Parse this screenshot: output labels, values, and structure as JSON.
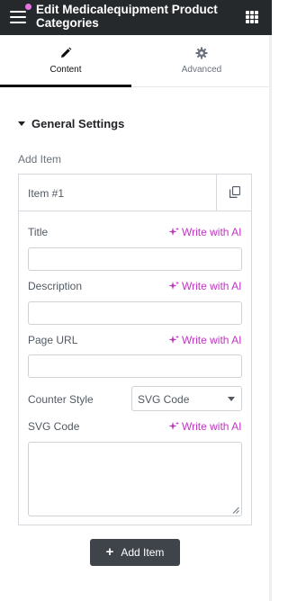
{
  "header": {
    "title": "Edit Medicalequipment Product Categories"
  },
  "tabs": [
    {
      "label": "Content",
      "icon": "pencil-icon",
      "active": true
    },
    {
      "label": "Advanced",
      "icon": "gear-icon",
      "active": false
    }
  ],
  "section": {
    "title": "General Settings"
  },
  "repeater": {
    "label": "Add Item",
    "item_title": "Item #1",
    "fields": {
      "title_label": "Title",
      "description_label": "Description",
      "page_url_label": "Page URL",
      "counter_style_label": "Counter Style",
      "counter_style_value": "SVG Code",
      "svg_code_label": "SVG Code"
    },
    "ai_label": "Write with AI"
  },
  "add_button": {
    "label": "Add Item"
  },
  "colors": {
    "header_bg": "#26292c",
    "ai_accent": "#c036c0",
    "button_bg": "#3f444b"
  }
}
